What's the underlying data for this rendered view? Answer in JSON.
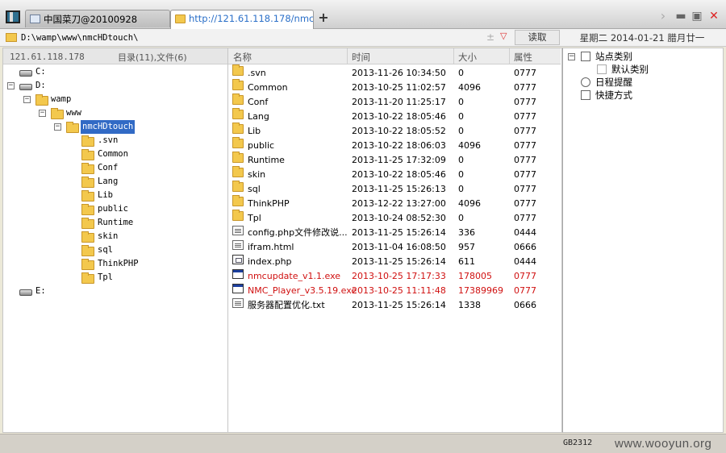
{
  "tabs": [
    {
      "label": "中国菜刀@20100928"
    },
    {
      "label": "http://121.61.118.178/nmcH..."
    }
  ],
  "address": {
    "path": "D:\\wamp\\www\\nmcHDtouch\\",
    "read_label": "读取"
  },
  "date_label": "星期二 2014-01-21 腊月廿一",
  "tree": {
    "host": "121.61.118.178",
    "count": "目录(11),文件(6)",
    "nodes": [
      {
        "label": "C:"
      },
      {
        "label": "D:"
      },
      {
        "label": "wamp"
      },
      {
        "label": "www"
      },
      {
        "label": "nmcHDtouch"
      },
      {
        "label": ".svn"
      },
      {
        "label": "Common"
      },
      {
        "label": "Conf"
      },
      {
        "label": "Lang"
      },
      {
        "label": "Lib"
      },
      {
        "label": "public"
      },
      {
        "label": "Runtime"
      },
      {
        "label": "skin"
      },
      {
        "label": "sql"
      },
      {
        "label": "ThinkPHP"
      },
      {
        "label": "Tpl"
      },
      {
        "label": "E:"
      }
    ]
  },
  "file_list": {
    "columns": [
      "名称",
      "时间",
      "大小",
      "属性"
    ],
    "rows": [
      {
        "name": ".svn",
        "time": "2013-11-26 10:34:50",
        "size": "0",
        "attr": "0777"
      },
      {
        "name": "Common",
        "time": "2013-10-25 11:02:57",
        "size": "4096",
        "attr": "0777"
      },
      {
        "name": "Conf",
        "time": "2013-11-20 11:25:17",
        "size": "0",
        "attr": "0777"
      },
      {
        "name": "Lang",
        "time": "2013-10-22 18:05:46",
        "size": "0",
        "attr": "0777"
      },
      {
        "name": "Lib",
        "time": "2013-10-22 18:05:52",
        "size": "0",
        "attr": "0777"
      },
      {
        "name": "public",
        "time": "2013-10-22 18:06:03",
        "size": "4096",
        "attr": "0777"
      },
      {
        "name": "Runtime",
        "time": "2013-11-25 17:32:09",
        "size": "0",
        "attr": "0777"
      },
      {
        "name": "skin",
        "time": "2013-10-22 18:05:46",
        "size": "0",
        "attr": "0777"
      },
      {
        "name": "sql",
        "time": "2013-11-25 15:26:13",
        "size": "0",
        "attr": "0777"
      },
      {
        "name": "ThinkPHP",
        "time": "2013-12-22 13:27:00",
        "size": "4096",
        "attr": "0777"
      },
      {
        "name": "Tpl",
        "time": "2013-10-24 08:52:30",
        "size": "0",
        "attr": "0777"
      },
      {
        "name": "config.php文件修改说...",
        "time": "2013-11-25 15:26:14",
        "size": "336",
        "attr": "0444"
      },
      {
        "name": "ifram.html",
        "time": "2013-11-04 16:08:50",
        "size": "957",
        "attr": "0666"
      },
      {
        "name": "index.php",
        "time": "2013-11-25 15:26:14",
        "size": "611",
        "attr": "0444"
      },
      {
        "name": "nmcupdate_v1.1.exe",
        "time": "2013-10-25 17:17:33",
        "size": "178005",
        "attr": "0777"
      },
      {
        "name": "NMC_Player_v3.5.19.exe",
        "time": "2013-10-25 11:11:48",
        "size": "17389969",
        "attr": "0777"
      },
      {
        "name": "服务器配置优化.txt",
        "time": "2013-11-25 15:26:14",
        "size": "1338",
        "attr": "0666"
      }
    ]
  },
  "right_tree": {
    "items": [
      {
        "label": "站点类别"
      },
      {
        "label": "默认类别"
      },
      {
        "label": "日程提醒"
      },
      {
        "label": "快捷方式"
      }
    ]
  },
  "status": {
    "encoding": "GB2312",
    "watermark": "www.wooyun.org"
  },
  "colors": {
    "selection": "#316ac5",
    "executable_text": "#d01010",
    "folder": "#f3c84d"
  }
}
